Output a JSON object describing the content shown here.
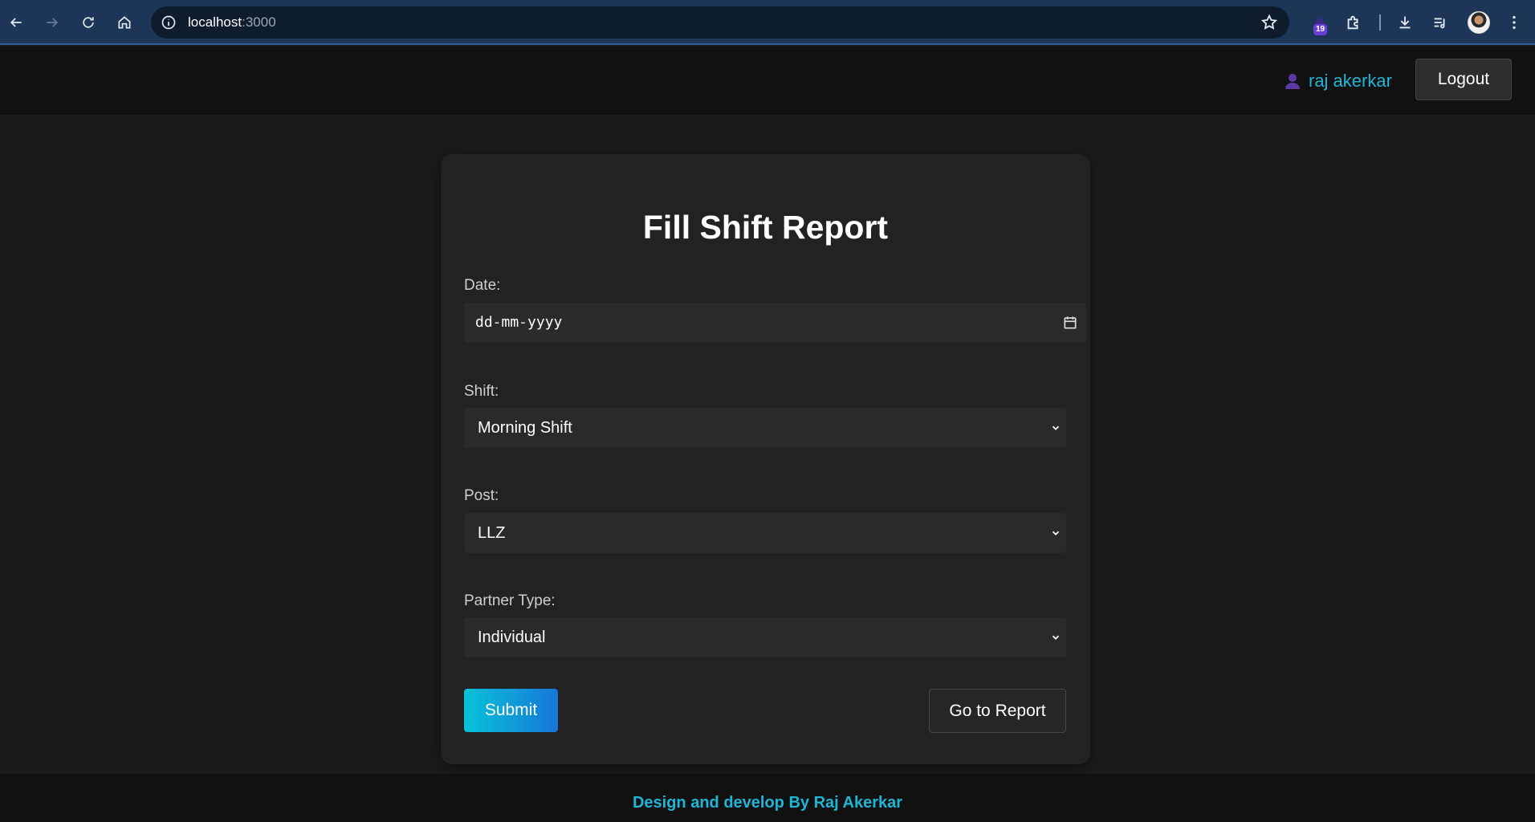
{
  "browser": {
    "url_host": "localhost",
    "url_port": ":3000",
    "extension_badge": "19"
  },
  "header": {
    "username": "raj akerkar",
    "logout_label": "Logout"
  },
  "form": {
    "title": "Fill Shift Report",
    "date": {
      "label": "Date:",
      "placeholder": "dd-mm-yyyy"
    },
    "shift": {
      "label": "Shift:",
      "value": "Morning Shift"
    },
    "post": {
      "label": "Post:",
      "value": "LLZ"
    },
    "partner_type": {
      "label": "Partner Type:",
      "value": "Individual"
    },
    "submit_label": "Submit",
    "goto_report_label": "Go to Report"
  },
  "footer": {
    "text": "Design and develop By Raj Akerkar"
  },
  "colors": {
    "accent": "#1fb6d6",
    "submit_gradient_start": "#08c2d8",
    "submit_gradient_end": "#1677d8",
    "page_bg": "#1b1b1b",
    "card_bg": "#222222"
  }
}
